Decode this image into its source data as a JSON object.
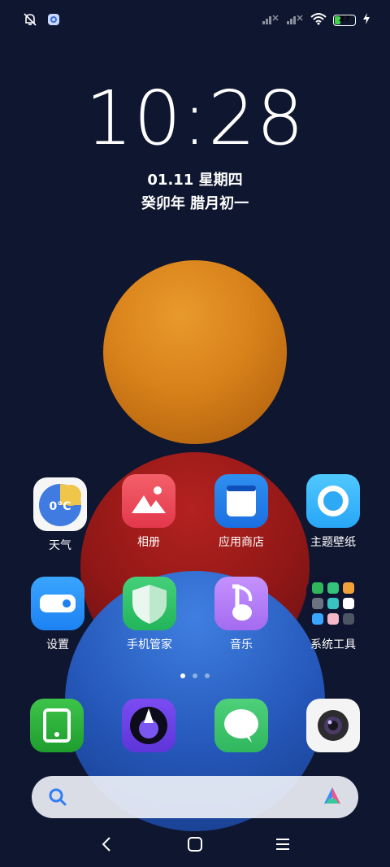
{
  "status_bar": {
    "left_icons": [
      "bell-muted-icon",
      "app-notification-icon"
    ],
    "right_icons": [
      "signal-no-sim-icon",
      "signal-no-sim-icon",
      "wifi-icon",
      "battery-icon",
      "charging-icon"
    ],
    "battery_level": "27",
    "battery_fraction": 0.27,
    "battery_color": "#43d24b"
  },
  "clock": {
    "time": "10:28",
    "date": "01.11 星期四",
    "lunar": "癸卯年 腊月初一"
  },
  "weather_widget": {
    "temp_text": "0°C"
  },
  "apps": {
    "weather": {
      "label": "天气",
      "icon": "weather-icon"
    },
    "gallery": {
      "label": "相册",
      "icon": "gallery-icon"
    },
    "app_store": {
      "label": "应用商店",
      "icon": "app-store-icon"
    },
    "themes": {
      "label": "主题壁纸",
      "icon": "themes-icon"
    },
    "settings": {
      "label": "设置",
      "icon": "settings-icon"
    },
    "security": {
      "label": "手机管家",
      "icon": "security-shield-icon"
    },
    "music": {
      "label": "音乐",
      "icon": "music-note-icon"
    },
    "system_tools": {
      "label": "系统工具",
      "icon": "folder-icon"
    }
  },
  "dock": [
    "notes-icon",
    "browser-icon",
    "messages-icon",
    "camera-icon"
  ],
  "page_indicator": {
    "pages": 3,
    "active": 0
  },
  "search_bar": {
    "left_icon": "search-icon",
    "right_icon": "assistant-icon"
  },
  "nav_bar": {
    "buttons": [
      "back-icon",
      "home-icon",
      "recents-icon"
    ]
  },
  "colors": {
    "background": "#0f1630",
    "accent_blue": "#1c82f2",
    "accent_green": "#22b55a",
    "accent_red": "#e2384b"
  }
}
